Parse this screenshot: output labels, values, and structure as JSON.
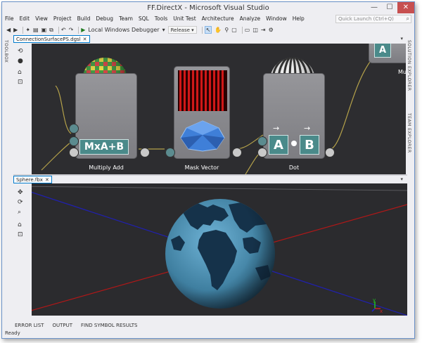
{
  "window": {
    "title": "FF.DirectX - Microsoft Visual Studio"
  },
  "window_controls": {
    "minimize": "—",
    "maximize": "☐",
    "close": "✕"
  },
  "menu": [
    "File",
    "Edit",
    "View",
    "Project",
    "Build",
    "Debug",
    "Team",
    "SQL",
    "Tools",
    "Unit Test",
    "Architecture",
    "Analyze",
    "Window",
    "Help"
  ],
  "quick_launch": {
    "placeholder": "Quick Launch (Ctrl+Q)"
  },
  "toolbar": {
    "debugger": "Local Windows Debugger",
    "configuration": "Release"
  },
  "side_panels": {
    "left": "TOOLBOX",
    "right_1": "SOLUTION EXPLORER",
    "right_2": "TEAM EXPLORER"
  },
  "designer": {
    "tab": "ConnectionSurfacePS.dgsl",
    "nodes": [
      {
        "label": "Multiply Add",
        "op": "MxA+B"
      },
      {
        "label": "Mask Vector"
      },
      {
        "label": "Dot",
        "op_a": "A",
        "op_b": "B"
      },
      {
        "label": "Mu",
        "op": "A"
      }
    ]
  },
  "viewer": {
    "tab": "Sphere.fbx"
  },
  "bottom_tabs": [
    "ERROR LIST",
    "OUTPUT",
    "FIND SYMBOL RESULTS"
  ],
  "status": {
    "text": "Ready"
  },
  "colors": {
    "accent": "#007acc",
    "close": "#c75050",
    "node_teal": "#4a8a8a",
    "canvas": "#2d2d30"
  }
}
